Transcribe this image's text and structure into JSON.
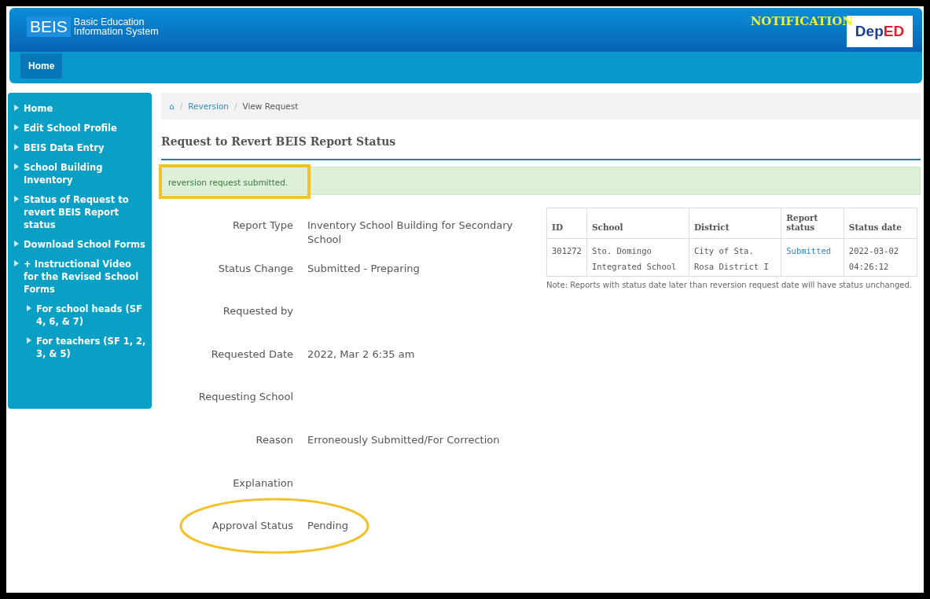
{
  "header": {
    "logo": {
      "abbr": "BEIS",
      "name_lines": [
        "Basic Education",
        "Information System"
      ]
    },
    "notification": "NOTIFICATION",
    "agency_logo": {
      "left": "Dep",
      "right": "ED"
    }
  },
  "nav": [
    {
      "label": "Home",
      "selected": true
    }
  ],
  "sidebar": {
    "items": [
      {
        "label": "Home"
      },
      {
        "label": "Edit School Profile"
      },
      {
        "label": "BEIS Data Entry"
      },
      {
        "label": "School Building Inventory"
      },
      {
        "label": "Status of Request to revert BEIS Report status"
      },
      {
        "label": "Download School Forms"
      },
      {
        "label": "+ Instructional Video for the Revised School Forms",
        "children": [
          {
            "label": "For school heads (SF 4, 6, & 7)"
          },
          {
            "label": "For teachers (SF 1, 2, 3, & 5)"
          }
        ]
      }
    ]
  },
  "breadcrumb": {
    "home_icon": "⌂",
    "separator": "/",
    "items": [
      {
        "label": "Reversion",
        "link": true
      },
      {
        "label": "View Request",
        "link": false
      }
    ]
  },
  "title": "Request to Revert BEIS Report Status",
  "alert": {
    "message": "reversion request submitted.",
    "highlighted": true
  },
  "fields": [
    {
      "label": "Report Type",
      "value": "Inventory School Building for Secondary School"
    },
    {
      "label": "Status Change",
      "value": "Submitted - Preparing"
    },
    {
      "label": "Requested by"
    },
    {
      "label": "Requested Date",
      "value": "2022, Mar 2 6:35 am"
    },
    {
      "label": "Requesting School"
    },
    {
      "label": "Reason",
      "value": "Erroneously Submitted/For Correction"
    },
    {
      "label": "Explanation"
    },
    {
      "label": "Approval Status",
      "value": "Pending",
      "highlighted": true
    }
  ],
  "table": {
    "columns": [
      "ID",
      "School",
      "District",
      "Report status",
      "Status date"
    ],
    "rows": [
      [
        "301272",
        "Sto. Domingo Integrated School",
        "City of Sta. Rosa District I",
        "Submitted",
        "2022-03-02 04:26:12"
      ]
    ]
  },
  "note": "Note: Reports with status date later than reversion request date will have status unchanged."
}
